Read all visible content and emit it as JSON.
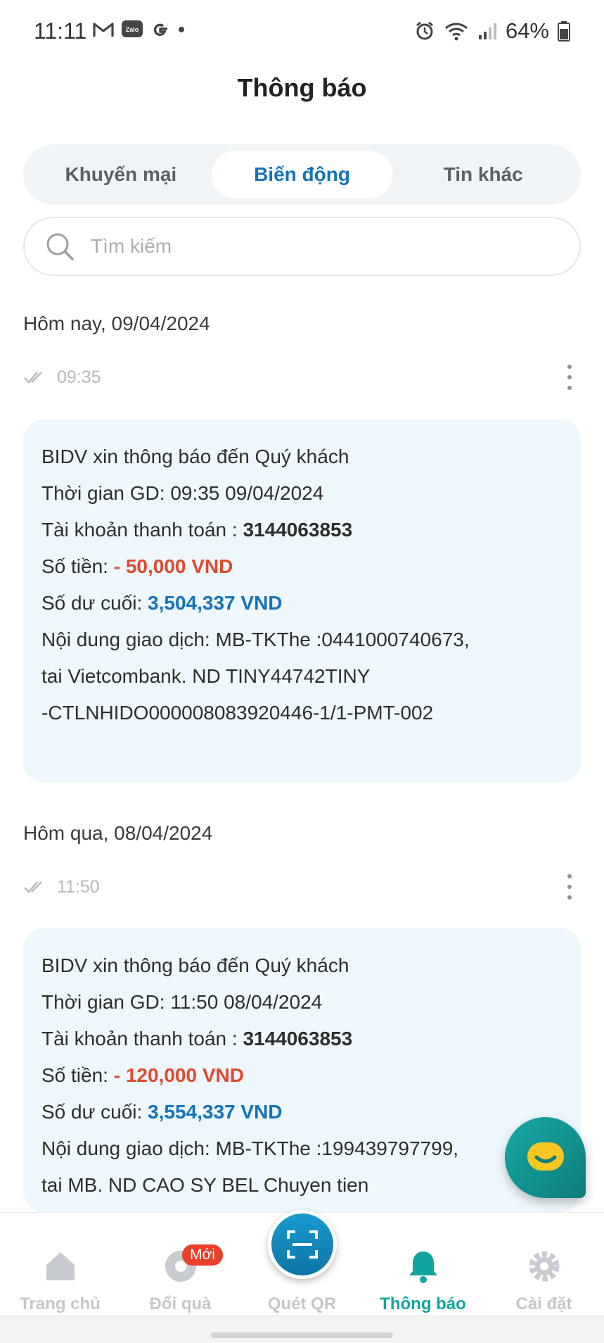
{
  "status_bar": {
    "time": "11:11",
    "app_icons": [
      "gmail-icon",
      "zalo-icon",
      "google-icon"
    ],
    "battery": "64%"
  },
  "header": {
    "title": "Thông báo"
  },
  "tabs": [
    {
      "label": "Khuyến mại",
      "active": false
    },
    {
      "label": "Biến động",
      "active": true
    },
    {
      "label": "Tin khác",
      "active": false
    }
  ],
  "search": {
    "placeholder": "Tìm kiếm"
  },
  "groups": [
    {
      "date": "Hôm nay, 09/04/2024",
      "time": "09:35",
      "card": {
        "line1": "BIDV xin thông báo đến Quý khách",
        "line2": "Thời gian GD: 09:35 09/04/2024",
        "account_label": "Tài khoản thanh toán : ",
        "account_value": "3144063853",
        "amount_label": "Số tiền: ",
        "amount_value": "- 50,000 VND",
        "balance_label": "Số dư cuối: ",
        "balance_value": "3,504,337 VND",
        "content1": "Nội dung giao dịch: MB-TKThe :0441000740673,",
        "content2": "tai Vietcombank. ND TINY44742TINY",
        "content3": "-CTLNHIDO000008083920446-1/1-PMT-002"
      }
    },
    {
      "date": "Hôm qua, 08/04/2024",
      "time": "11:50",
      "card": {
        "line1": "BIDV xin thông báo đến Quý khách",
        "line2": "Thời gian GD: 11:50 08/04/2024",
        "account_label": "Tài khoản thanh toán : ",
        "account_value": "3144063853",
        "amount_label": "Số tiền: ",
        "amount_value": "- 120,000 VND",
        "balance_label": "Số dư cuối: ",
        "balance_value": "3,554,337 VND",
        "content1": "Nội dung giao dịch: MB-TKThe :199439797799,",
        "content2": "tai MB. ND CAO SY BEL Chuyen tien"
      }
    }
  ],
  "bottom_nav": {
    "items": [
      {
        "label": "Trang chủ",
        "icon": "home-icon"
      },
      {
        "label": "Đổi quà",
        "icon": "gift-icon",
        "badge": "Mới"
      },
      {
        "label": "Quét QR",
        "icon": "qr-scan-icon"
      },
      {
        "label": "Thông báo",
        "icon": "bell-icon",
        "active": true
      },
      {
        "label": "Cài đặt",
        "icon": "gear-icon"
      }
    ]
  },
  "colors": {
    "accent": "#1473b8",
    "negative": "#e04a2f",
    "nav_active": "#12a5a0",
    "card_bg": "#eef7fc"
  }
}
